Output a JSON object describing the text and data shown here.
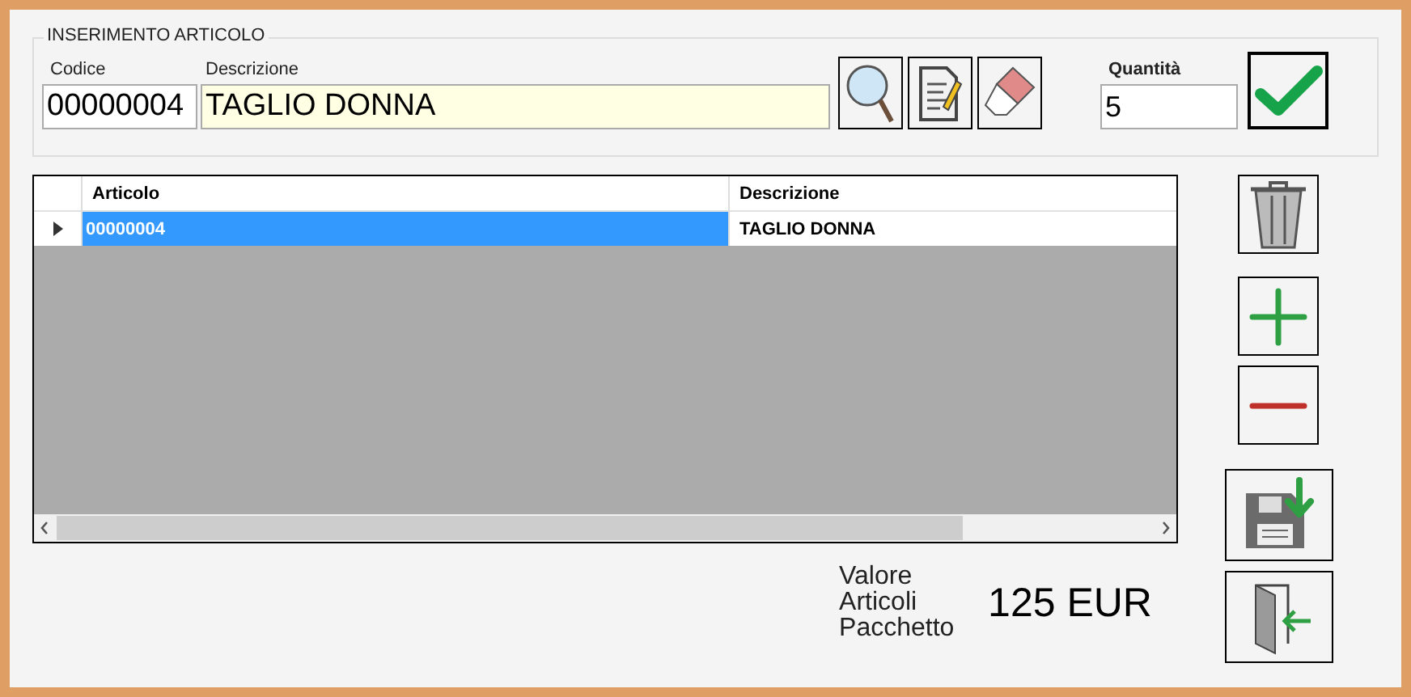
{
  "group": {
    "title": "INSERIMENTO ARTICOLO",
    "code": {
      "label": "Codice",
      "value": "00000004"
    },
    "description": {
      "label": "Descrizione",
      "value": "TAGLIO DONNA"
    },
    "quantity": {
      "label": "Quantità",
      "value": "5"
    }
  },
  "table": {
    "columns": [
      "Articolo",
      "Descrizione"
    ],
    "rows": [
      {
        "cells": [
          "00000004",
          "TAGLIO DONNA"
        ],
        "selected": true
      }
    ]
  },
  "summary": {
    "label": "Valore Articoli Pacchetto",
    "value": "125 EUR"
  }
}
